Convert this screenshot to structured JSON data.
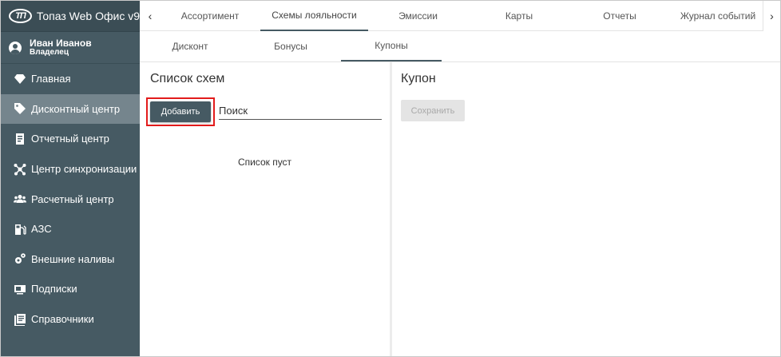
{
  "app": {
    "logo_text": "ТП",
    "title": "Топаз Web Офис v9"
  },
  "user": {
    "name": "Иван Иванов",
    "role": "Владелец"
  },
  "sidebar": {
    "items": [
      {
        "label": "Главная",
        "icon": "diamond-icon"
      },
      {
        "label": "Дисконтный центр",
        "icon": "tag-icon",
        "active": true
      },
      {
        "label": "Отчетный центр",
        "icon": "report-icon"
      },
      {
        "label": "Центр синхронизации",
        "icon": "network-icon"
      },
      {
        "label": "Расчетный центр",
        "icon": "users-icon"
      },
      {
        "label": "АЗС",
        "icon": "fuel-station-icon"
      },
      {
        "label": "Внешние наливы",
        "icon": "gears-icon"
      },
      {
        "label": "Подписки",
        "icon": "subscription-icon"
      },
      {
        "label": "Справочники",
        "icon": "book-icon"
      }
    ]
  },
  "tabs": {
    "items": [
      {
        "label": "Ассортимент"
      },
      {
        "label": "Схемы лояльности",
        "active": true
      },
      {
        "label": "Эмиссии"
      },
      {
        "label": "Карты"
      },
      {
        "label": "Отчеты"
      },
      {
        "label": "Журнал событий"
      }
    ]
  },
  "subtabs": {
    "items": [
      {
        "label": "Дисконт"
      },
      {
        "label": "Бонусы"
      },
      {
        "label": "Купоны",
        "active": true
      }
    ]
  },
  "left_panel": {
    "title": "Список схем",
    "add_label": "Добавить",
    "search_placeholder": "Поиск",
    "empty_text": "Список пуст"
  },
  "right_panel": {
    "title": "Купон",
    "save_label": "Сохранить"
  },
  "colors": {
    "sidebar_bg": "#465a63",
    "sidebar_active": "#75858d",
    "highlight": "#e21b1b"
  }
}
